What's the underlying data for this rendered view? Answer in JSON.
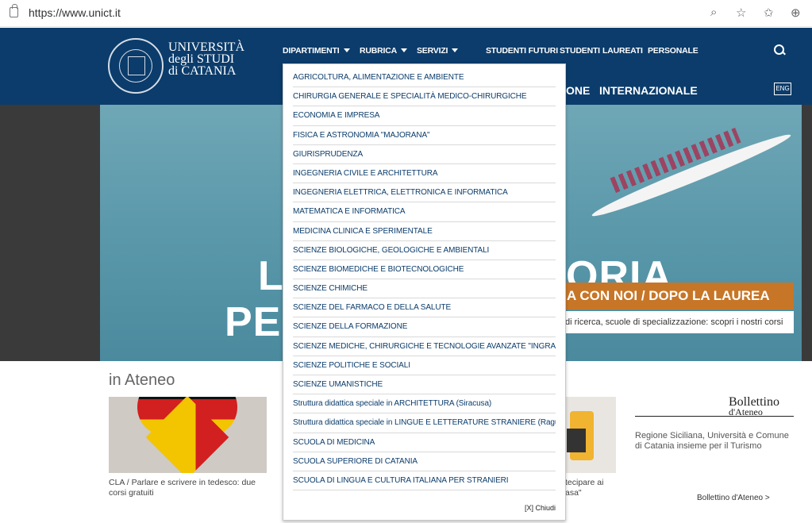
{
  "browser": {
    "url": "https://www.unict.it"
  },
  "logo": {
    "line1": "UNIVERSITÀ",
    "line2": "degli STUDI",
    "line3": "di CATANIA"
  },
  "topnav": [
    {
      "label": "DIPARTIMENTI",
      "dropdown": true
    },
    {
      "label": "RUBRICA",
      "dropdown": true
    },
    {
      "label": "SERVIZI",
      "dropdown": true
    },
    {
      "label": "STUDENTI FUTURI",
      "dropdown": false
    },
    {
      "label": "STUDENTI",
      "dropdown": false
    },
    {
      "label": "LAUREATI",
      "dropdown": false
    },
    {
      "label": "PERSONALE",
      "dropdown": false
    }
  ],
  "subnav": {
    "partial": "ONE",
    "internazionale": "INTERNAZIONALE",
    "lang": "ENG"
  },
  "hero": {
    "word1": "L",
    "word1b": "ORIA.",
    "word2": "PE",
    "orange_text": "A CON NOI / DOPO LA LAUREA",
    "white_text": "di ricerca, scuole di specializzazione: scopri i nostri corsi"
  },
  "ateneo": {
    "title": "in Ateneo",
    "card1_caption": "CLA / Parlare e scrivere in tedesco: due corsi gratuiti",
    "card2_caption": "tecipare ai asa\"",
    "bollettino_title_small": "d'Ateneo",
    "bollettino_title": "Bollettino",
    "bollettino_text": "Regione Siciliana, Università e Comune di Catania insieme per il Turismo",
    "bollettino_link": "Bollettino d'Ateneo >"
  },
  "dropdown": {
    "items": [
      "AGRICOLTURA, ALIMENTAZIONE E AMBIENTE",
      "CHIRURGIA GENERALE E SPECIALITÀ MEDICO-CHIRURGICHE",
      "ECONOMIA E IMPRESA",
      "FISICA E ASTRONOMIA \"MAJORANA\"",
      "GIURISPRUDENZA",
      "INGEGNERIA CIVILE E ARCHITETTURA",
      "INGEGNERIA ELETTRICA, ELETTRONICA E INFORMATICA",
      "MATEMATICA E INFORMATICA",
      "MEDICINA CLINICA E SPERIMENTALE",
      "SCIENZE BIOLOGICHE, GEOLOGICHE E AMBIENTALI",
      "SCIENZE BIOMEDICHE E BIOTECNOLOGICHE",
      "SCIENZE CHIMICHE",
      "SCIENZE DEL FARMACO E DELLA SALUTE",
      "SCIENZE DELLA FORMAZIONE",
      "SCIENZE MEDICHE, CHIRURGICHE E TECNOLOGIE AVANZATE \"INGRASSIA\"",
      "SCIENZE POLITICHE E SOCIALI",
      "SCIENZE UMANISTICHE",
      "Struttura didattica speciale in ARCHITETTURA (Siracusa)",
      "Struttura didattica speciale in LINGUE E LETTERATURE STRANIERE (Ragusa)",
      "SCUOLA DI MEDICINA",
      "SCUOLA SUPERIORE DI CATANIA",
      "SCUOLA DI LINGUA E CULTURA ITALIANA PER STRANIERI"
    ],
    "close_label": "[X] Chiudi"
  },
  "colors": {
    "header": "#0b3c6b",
    "accent": "#c77627",
    "menu_text": "#0b3c6b"
  }
}
